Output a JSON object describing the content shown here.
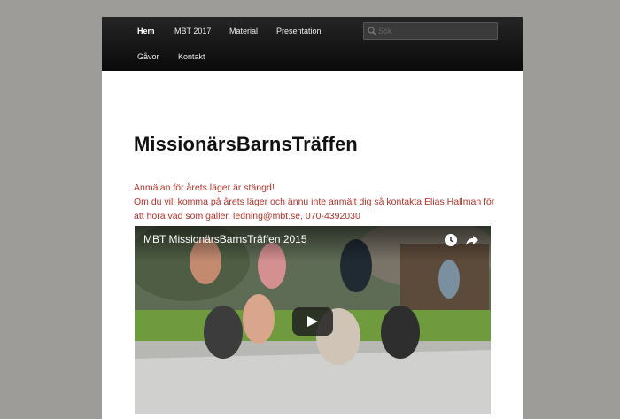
{
  "nav": {
    "items": [
      {
        "label": "Hem",
        "active": true
      },
      {
        "label": "MBT 2017",
        "active": false
      },
      {
        "label": "Material",
        "active": false
      },
      {
        "label": "Presentation",
        "active": false
      },
      {
        "label": "Gåvor",
        "active": false
      },
      {
        "label": "Kontakt",
        "active": false
      }
    ],
    "search_placeholder": "Sök"
  },
  "main": {
    "title": "MissionärsBarnsTräffen",
    "notice_lines": [
      "Anmälan för årets läger är stängd!",
      "Om du vill komma på årets läger och ännu inte anmält dig så kontakta Elias Hallman för",
      "att höra vad som gäller. ledning@mbt.se, 070-4392030"
    ]
  },
  "video": {
    "title": "MBT MissionärsBarnsTräffen 2015",
    "icons": [
      "watch-later-icon",
      "share-icon",
      "play-icon"
    ]
  },
  "colors": {
    "background": "#9d9c98",
    "nav_bg": "#111111",
    "notice_text": "#b5322a",
    "title_text": "#111111"
  }
}
